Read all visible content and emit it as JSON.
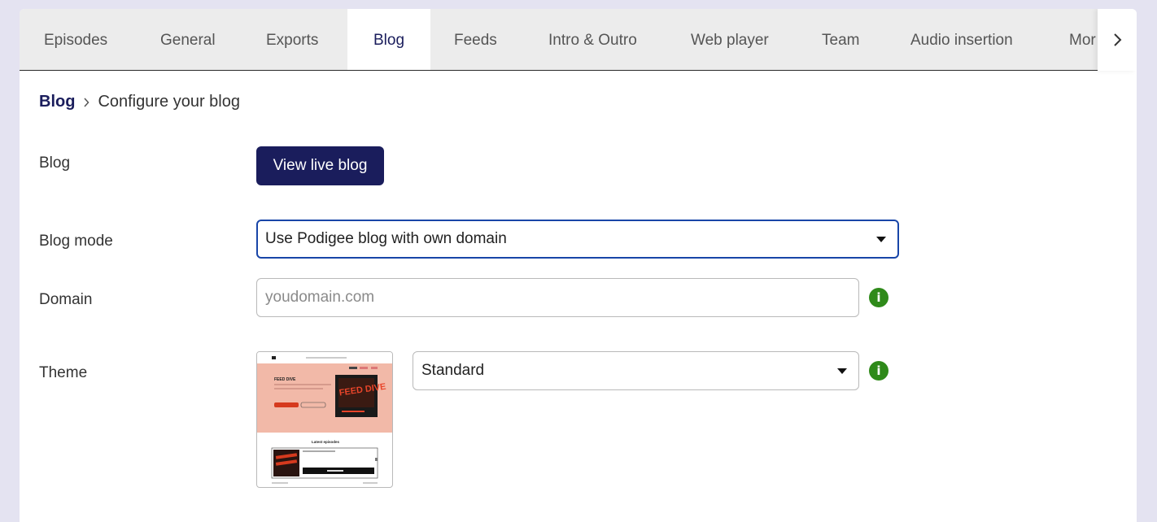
{
  "tabs": [
    {
      "label": "Episodes",
      "active": false
    },
    {
      "label": "General",
      "active": false
    },
    {
      "label": "Exports",
      "active": false
    },
    {
      "label": "Blog",
      "active": true
    },
    {
      "label": "Feeds",
      "active": false
    },
    {
      "label": "Intro & Outro",
      "active": false
    },
    {
      "label": "Web player",
      "active": false
    },
    {
      "label": "Team",
      "active": false
    },
    {
      "label": "Audio insertion",
      "active": false
    },
    {
      "label": "Mor",
      "active": false
    }
  ],
  "breadcrumb": {
    "parent": "Blog",
    "current": "Configure your blog"
  },
  "form": {
    "blog_label": "Blog",
    "view_live_blog_button": "View live blog",
    "blog_mode_label": "Blog mode",
    "blog_mode_value": "Use Podigee blog with own domain",
    "domain_label": "Domain",
    "domain_placeholder": "youdomain.com",
    "domain_value": "",
    "theme_label": "Theme",
    "theme_value": "Standard"
  },
  "theme_preview": {
    "title": "FEED DIVE",
    "artwork_text": "FEED DIVE",
    "section_title": "Latest episodes"
  },
  "colors": {
    "accent": "#1a1d5c",
    "focus_border": "#1845a8",
    "info_icon": "#2f8a1a",
    "page_background": "#e4e3f1",
    "tab_bar": "#ececec",
    "theme_hero": "#f2b9a8"
  },
  "icons": {
    "tab_scroll": "chevron-right-icon",
    "breadcrumb_separator": "chevron-right-icon",
    "select_caret": "caret-down-icon",
    "info": "info-icon"
  }
}
